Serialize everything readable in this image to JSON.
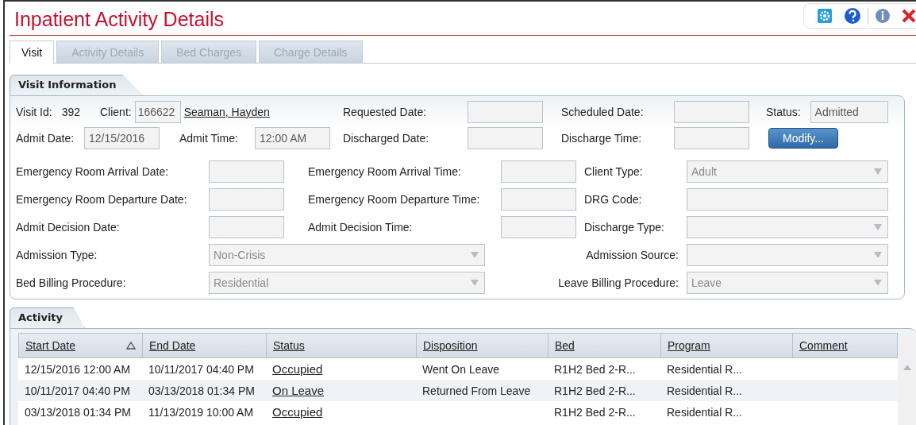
{
  "window": {
    "title": "Inpatient Activity Details"
  },
  "tabs": [
    {
      "label": "Visit",
      "selected": true
    },
    {
      "label": "Activity Details",
      "selected": false
    },
    {
      "label": "Bed Charges",
      "selected": false
    },
    {
      "label": "Charge Details",
      "selected": false
    }
  ],
  "visit_information": {
    "title": "Visit Information",
    "visit_id": {
      "label": "Visit Id:",
      "value": "392"
    },
    "client": {
      "label": "Client:",
      "id": "166622",
      "name": "Seaman, Hayden"
    },
    "requested_date": {
      "label": "Requested Date:"
    },
    "scheduled_date": {
      "label": "Scheduled Date:"
    },
    "status": {
      "label": "Status:",
      "value": "Admitted"
    },
    "admit_date": {
      "label": "Admit Date:",
      "value": "12/15/2016"
    },
    "admit_time": {
      "label": "Admit Time:",
      "value": "12:00 AM"
    },
    "discharged_date": {
      "label": "Discharged Date:"
    },
    "discharge_time": {
      "label": "Discharge Time:"
    },
    "modify_button": "Modify...",
    "rows": [
      [
        {
          "label": "Emergency Room Arrival Date:",
          "kind": "box"
        },
        {
          "label": "Emergency Room Arrival Time:",
          "kind": "box"
        },
        {
          "label": "Client Type:",
          "kind": "select",
          "value": "Adult"
        }
      ],
      [
        {
          "label": "Emergency Room Departure Date:",
          "kind": "box"
        },
        {
          "label": "Emergency Room Departure Time:",
          "kind": "box"
        },
        {
          "label": "DRG Code:",
          "kind": "box"
        }
      ],
      [
        {
          "label": "Admit Decision Date:",
          "kind": "box"
        },
        {
          "label": "Admit Decision Time:",
          "kind": "box"
        },
        {
          "label": "Discharge Type:",
          "kind": "select"
        }
      ],
      [
        {
          "label": "Admission Type:",
          "kind": "select",
          "value": "Non-Crisis"
        },
        {
          "label": "Admission Source:",
          "kind": "select"
        }
      ],
      [
        {
          "label": "Bed Billing Procedure:",
          "kind": "select",
          "value": "Residential"
        },
        {
          "label": "Leave Billing Procedure:",
          "kind": "select",
          "value": "Leave"
        }
      ]
    ]
  },
  "activity": {
    "title": "Activity",
    "columns": [
      {
        "label": "Start Date",
        "sorted": true
      },
      {
        "label": "End Date",
        "sorted": false
      },
      {
        "label": "Status",
        "sorted": false
      },
      {
        "label": "Disposition",
        "sorted": false
      },
      {
        "label": "Bed",
        "sorted": false
      },
      {
        "label": "Program",
        "sorted": false
      },
      {
        "label": "Comment",
        "sorted": false
      }
    ],
    "rows": [
      {
        "start_date": "12/15/2016 12:00 AM",
        "end_date": "10/11/2017 04:40 PM",
        "status": "Occupied",
        "disposition": "Went On Leave",
        "bed": "R1H2 Bed 2-R...",
        "program": "Residential R..."
      },
      {
        "start_date": "10/11/2017 04:40 PM",
        "end_date": "03/13/2018 01:34 PM",
        "status": "On Leave",
        "disposition": "Returned From Leave",
        "bed": "R1H2 Bed 2-R...",
        "program": "Residential R..."
      },
      {
        "start_date": "03/13/2018 01:34 PM",
        "end_date": "11/13/2019 10:00 AM",
        "status": "Occupied",
        "bed": "R1H2 Bed 2-R...",
        "program": "Residential R..."
      }
    ]
  }
}
